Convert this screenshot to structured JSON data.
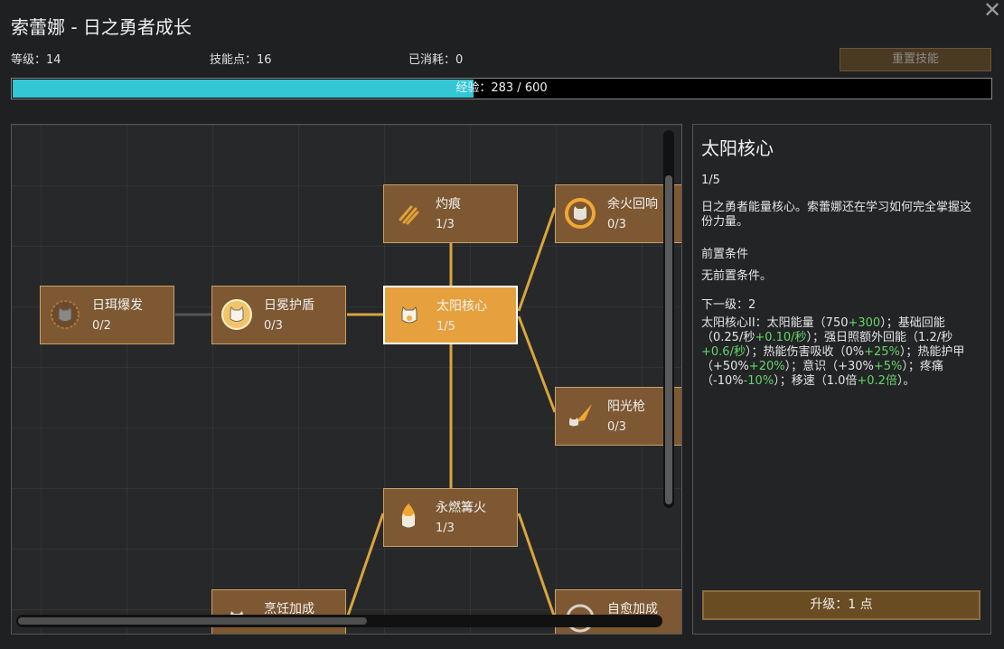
{
  "window": {
    "title": "索蕾娜 - 日之勇者成长",
    "close_icon": "close-icon"
  },
  "stats": {
    "level_label": "等级：14",
    "points_label": "技能点：16",
    "spent_label": "已消耗：0",
    "reset_label": "重置技能"
  },
  "xp": {
    "label": "经验：283 / 600",
    "current": 283,
    "max": 600
  },
  "tree": {
    "nodes": [
      {
        "name": "日珥爆发",
        "level": "0/2",
        "state": "locked",
        "icon": "sun-burst-icon"
      },
      {
        "name": "日冕护盾",
        "level": "0/3",
        "state": "normal",
        "icon": "sun-shield-icon"
      },
      {
        "name": "灼痕",
        "level": "1/3",
        "state": "normal",
        "icon": "scorch-mark-icon"
      },
      {
        "name": "太阳核心",
        "level": "1/5",
        "state": "selected",
        "icon": "solar-core-icon"
      },
      {
        "name": "余火回响",
        "level": "0/3",
        "state": "normal",
        "icon": "ember-echo-icon"
      },
      {
        "name": "阳光枪",
        "level": "0/3",
        "state": "normal",
        "icon": "sun-spear-icon"
      },
      {
        "name": "永燃篝火",
        "level": "1/3",
        "state": "normal",
        "icon": "eternal-bonfire-icon"
      },
      {
        "name": "烹饪加成",
        "level": "",
        "state": "normal",
        "icon": "cooking-bonus-icon"
      },
      {
        "name": "自愈加成",
        "level": "",
        "state": "normal",
        "icon": "self-heal-bonus-icon"
      }
    ]
  },
  "detail": {
    "title": "太阳核心",
    "level": "1/5",
    "description": "日之勇者能量核心。索蕾娜还在学习如何完全掌握这份力量。",
    "prereq_heading": "前置条件",
    "prereq_text": "无前置条件。",
    "next_heading": "下一级：2",
    "next_parts": [
      {
        "t": "太阳核心II：太阳能量（750",
        "g": false
      },
      {
        "t": "+300",
        "g": true
      },
      {
        "t": "）；基础回能（0.25/秒",
        "g": false
      },
      {
        "t": "+0.10/秒",
        "g": true
      },
      {
        "t": "）；强日照额外回能（1.2/秒",
        "g": false
      },
      {
        "t": "+0.6/秒",
        "g": true
      },
      {
        "t": "）；热能伤害吸收（0%",
        "g": false
      },
      {
        "t": "+25%",
        "g": true
      },
      {
        "t": "）；热能护甲（+50%",
        "g": false
      },
      {
        "t": "+20%",
        "g": true
      },
      {
        "t": "）；意识（+30%",
        "g": false
      },
      {
        "t": "+5%",
        "g": true
      },
      {
        "t": "）；疼痛（-10%",
        "g": false
      },
      {
        "t": "-10%",
        "g": true
      },
      {
        "t": "）；移速（1.0倍",
        "g": false
      },
      {
        "t": "+0.2倍",
        "g": true
      },
      {
        "t": "）。",
        "g": false
      }
    ],
    "upgrade_label": "升级：1 点"
  },
  "colors": {
    "xp_fill": "#33c7d6",
    "node_bg": "#7d5832",
    "node_selected": "#e6a13e",
    "node_locked": "#1a1a19",
    "link_active": "#d9a53c",
    "link_inactive": "#555555",
    "bonus_green": "#67d46a"
  }
}
